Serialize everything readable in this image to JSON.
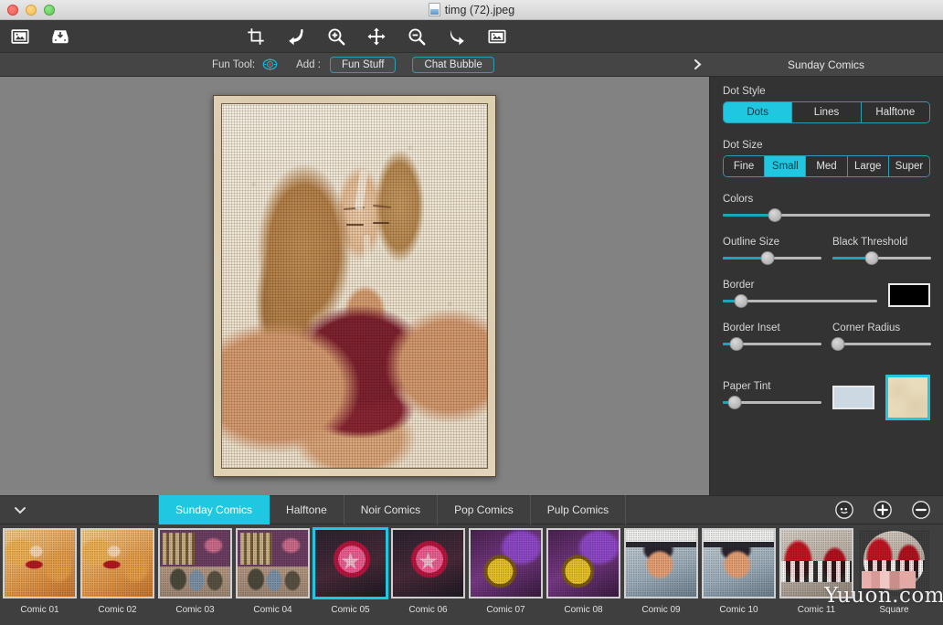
{
  "window": {
    "title": "timg (72).jpeg",
    "doc_icon": "document-icon",
    "traffic_lights": [
      "close-button",
      "minimize-button",
      "maximize-button"
    ]
  },
  "toolbar": {
    "items": [
      {
        "name": "image-frame-icon",
        "label": "Image"
      },
      {
        "name": "import-tray-icon",
        "label": "Import"
      },
      {
        "name": "crop-icon",
        "label": "Crop"
      },
      {
        "name": "undo-icon",
        "label": "Undo"
      },
      {
        "name": "zoom-in-icon",
        "label": "Zoom In"
      },
      {
        "name": "move-icon",
        "label": "Move"
      },
      {
        "name": "zoom-out-icon",
        "label": "Zoom Out"
      },
      {
        "name": "redo-icon",
        "label": "Redo"
      },
      {
        "name": "image-adjust-icon",
        "label": "Adjust"
      }
    ]
  },
  "options_bar": {
    "fun_tool_label": "Fun Tool:",
    "fun_tool_icon": "fun-tool-icon",
    "add_label": "Add :",
    "fun_stuff_button": "Fun Stuff",
    "chat_bubble_button": "Chat Bubble",
    "panel_title": "Sunday Comics",
    "expand_icon": "chevron-right-icon"
  },
  "right_panel": {
    "dot_style": {
      "label": "Dot Style",
      "options": [
        "Dots",
        "Lines",
        "Halftone"
      ],
      "selected": "Dots"
    },
    "dot_size": {
      "label": "Dot Size",
      "options": [
        "Fine",
        "Small",
        "Med",
        "Large",
        "Super"
      ],
      "selected": "Small"
    },
    "sliders": [
      {
        "label": "Colors",
        "value": 25
      },
      {
        "label": "Outline Size",
        "value": 45
      },
      {
        "label": "Black Threshold",
        "value": 40
      },
      {
        "label": "Border",
        "value": 12
      },
      {
        "label": "Border Inset",
        "value": 14
      },
      {
        "label": "Corner Radius",
        "value": 6
      },
      {
        "label": "Paper Tint",
        "value": 12
      }
    ],
    "border_color": "#000000",
    "tint_color": "#ccd9e2",
    "paper_texture_selected": true
  },
  "preset_bar": {
    "collapse_icon": "chevron-down-icon",
    "tabs": [
      {
        "label": "Sunday Comics",
        "selected": true
      },
      {
        "label": "Halftone",
        "selected": false
      },
      {
        "label": "Noir Comics",
        "selected": false
      },
      {
        "label": "Pop Comics",
        "selected": false
      },
      {
        "label": "Pulp Comics",
        "selected": false
      }
    ],
    "actions": [
      {
        "name": "more-options-icon",
        "label": "More"
      },
      {
        "name": "add-preset-icon",
        "label": "Add"
      },
      {
        "name": "remove-preset-icon",
        "label": "Remove"
      }
    ]
  },
  "thumbnails": [
    {
      "label": "Comic 01",
      "art": "tb-face",
      "selected": false
    },
    {
      "label": "Comic 02",
      "art": "tb-face",
      "selected": false
    },
    {
      "label": "Comic 03",
      "art": "tb-cans",
      "selected": false
    },
    {
      "label": "Comic 04",
      "art": "tb-cans",
      "selected": false
    },
    {
      "label": "Comic 05",
      "art": "tb-star",
      "selected": true
    },
    {
      "label": "Comic 06",
      "art": "tb-star",
      "selected": false
    },
    {
      "label": "Comic 07",
      "art": "tb-clock",
      "selected": false
    },
    {
      "label": "Comic 08",
      "art": "tb-clock",
      "selected": false
    },
    {
      "label": "Comic 09",
      "art": "tb-hat",
      "selected": false
    },
    {
      "label": "Comic 10",
      "art": "tb-hat",
      "selected": false
    },
    {
      "label": "Comic 11",
      "art": "tb-red",
      "selected": false
    },
    {
      "label": "Square",
      "art": "tb-square",
      "selected": false
    }
  ],
  "watermark": "Yuuon.com",
  "colors": {
    "accent": "#1fc8e0",
    "accent_border": "#2e9bb0",
    "slider_fill": "#18a8bd",
    "toolbar_bg": "#3b3b3b",
    "panel_bg": "#333333",
    "canvas_bg": "#828282"
  }
}
